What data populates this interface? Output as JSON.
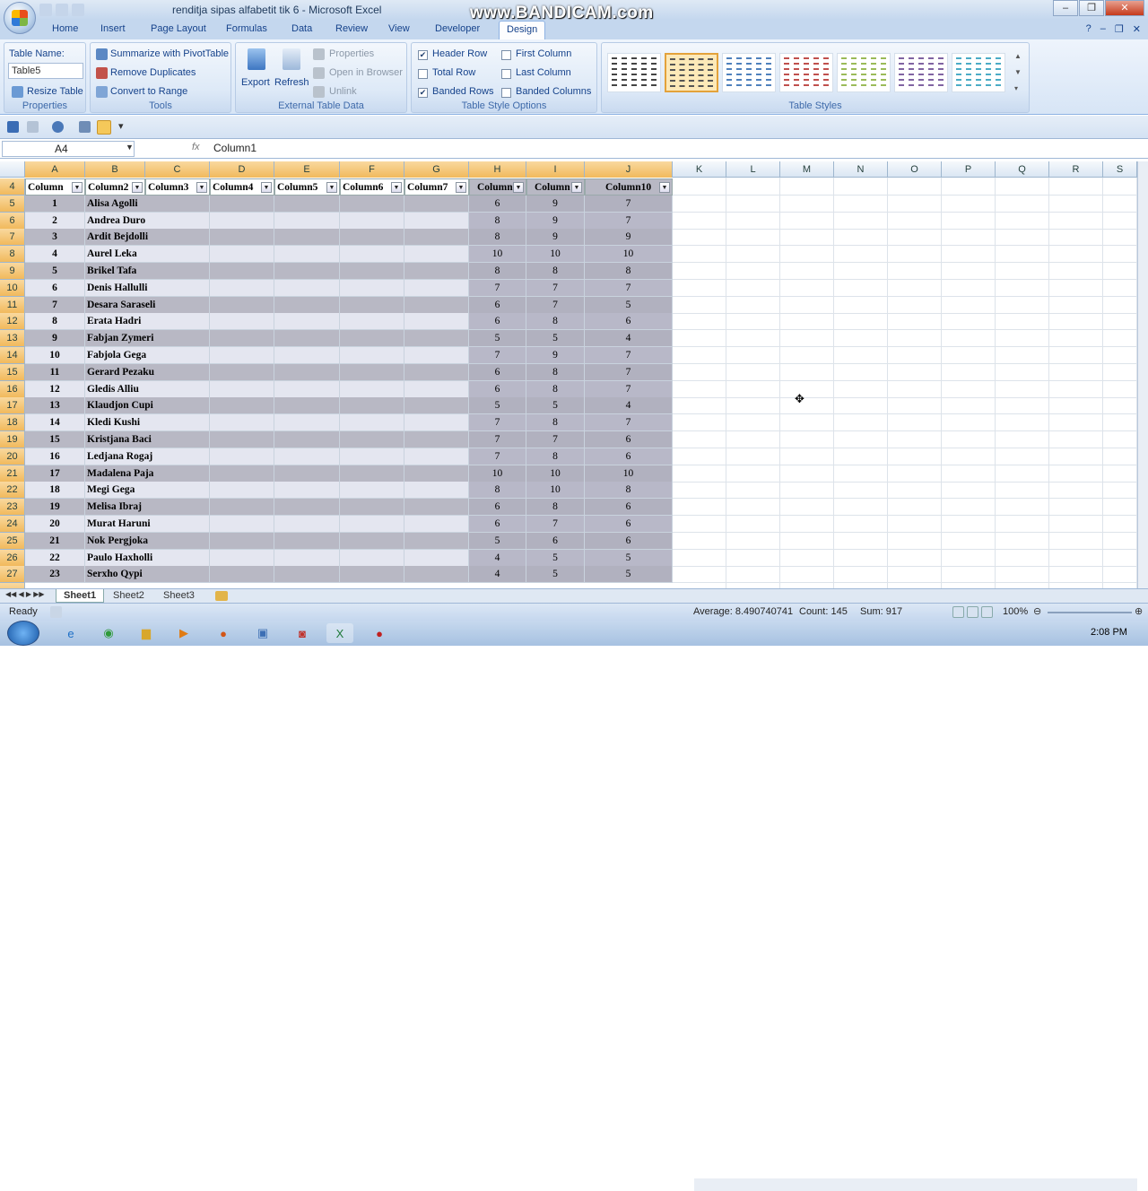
{
  "titlebar": {
    "title": "renditja sipas alfabetit tik 6 - Microsoft Excel",
    "watermark": "www.BANDICAM.com"
  },
  "tabs": [
    "Home",
    "Insert",
    "Page Layout",
    "Formulas",
    "Data",
    "Review",
    "View",
    "Developer",
    "Design"
  ],
  "active_tab": "Design",
  "ribbon": {
    "properties": {
      "label": "Properties",
      "table_name_label": "Table Name:",
      "table_name_value": "Table5",
      "resize": "Resize Table"
    },
    "tools": {
      "label": "Tools",
      "summarize": "Summarize with PivotTable",
      "remove_dup": "Remove Duplicates",
      "convert": "Convert to Range"
    },
    "external": {
      "label": "External Table Data",
      "export": "Export",
      "refresh": "Refresh",
      "properties": "Properties",
      "open_browser": "Open in Browser",
      "unlink": "Unlink"
    },
    "style_options": {
      "label": "Table Style Options",
      "header_row": "Header Row",
      "total_row": "Total Row",
      "banded_rows": "Banded Rows",
      "first_column": "First Column",
      "last_column": "Last Column",
      "banded_columns": "Banded Columns",
      "checked": {
        "header_row": true,
        "total_row": false,
        "banded_rows": true,
        "first_column": false,
        "last_column": false,
        "banded_columns": false
      }
    },
    "table_styles": {
      "label": "Table Styles",
      "colors": [
        "#444444",
        "#555555",
        "#4f81bd",
        "#c0504d",
        "#9bbb59",
        "#8064a2",
        "#4bacc6"
      ],
      "selected": 1
    }
  },
  "formula": {
    "name_box": "A4",
    "fx": "fx",
    "value": "Column1"
  },
  "columns": [
    "A",
    "B",
    "C",
    "D",
    "E",
    "F",
    "G",
    "H",
    "I",
    "J",
    "K",
    "L",
    "M",
    "N",
    "O",
    "P",
    "Q",
    "R",
    "S"
  ],
  "header_row": {
    "row": "4",
    "cells": [
      "Column",
      "Column2",
      "Column3",
      "Column4",
      "Column5",
      "Column6",
      "Column7",
      "Column",
      "Column",
      "Column10"
    ]
  },
  "rows": [
    {
      "r": "5",
      "n": "1",
      "name": "Alisa Agolli",
      "h": "6",
      "i": "9",
      "j": "7"
    },
    {
      "r": "6",
      "n": "2",
      "name": "Andrea Duro",
      "h": "8",
      "i": "9",
      "j": "7"
    },
    {
      "r": "7",
      "n": "3",
      "name": "Ardit Bejdolli",
      "h": "8",
      "i": "9",
      "j": "9"
    },
    {
      "r": "8",
      "n": "4",
      "name": "Aurel Leka",
      "h": "10",
      "i": "10",
      "j": "10"
    },
    {
      "r": "9",
      "n": "5",
      "name": "Brikel Tafa",
      "h": "8",
      "i": "8",
      "j": "8"
    },
    {
      "r": "10",
      "n": "6",
      "name": "Denis Hallulli",
      "h": "7",
      "i": "7",
      "j": "7"
    },
    {
      "r": "11",
      "n": "7",
      "name": "Desara Saraseli",
      "h": "6",
      "i": "7",
      "j": "5"
    },
    {
      "r": "12",
      "n": "8",
      "name": "Erata Hadri",
      "h": "6",
      "i": "8",
      "j": "6"
    },
    {
      "r": "13",
      "n": "9",
      "name": "Fabjan Zymeri",
      "h": "5",
      "i": "5",
      "j": "4"
    },
    {
      "r": "14",
      "n": "10",
      "name": "Fabjola Gega",
      "h": "7",
      "i": "9",
      "j": "7"
    },
    {
      "r": "15",
      "n": "11",
      "name": "Gerard Pezaku",
      "h": "6",
      "i": "8",
      "j": "7"
    },
    {
      "r": "16",
      "n": "12",
      "name": "Gledis Alliu",
      "h": "6",
      "i": "8",
      "j": "7"
    },
    {
      "r": "17",
      "n": "13",
      "name": "Klaudjon Cupi",
      "h": "5",
      "i": "5",
      "j": "4"
    },
    {
      "r": "18",
      "n": "14",
      "name": "Kledi Kushi",
      "h": "7",
      "i": "8",
      "j": "7"
    },
    {
      "r": "19",
      "n": "15",
      "name": "Kristjana Baci",
      "h": "7",
      "i": "7",
      "j": "6"
    },
    {
      "r": "20",
      "n": "16",
      "name": "Ledjana  Rogaj",
      "h": "7",
      "i": "8",
      "j": "6"
    },
    {
      "r": "21",
      "n": "17",
      "name": "Madalena Paja",
      "h": "10",
      "i": "10",
      "j": "10"
    },
    {
      "r": "22",
      "n": "18",
      "name": "Megi Gega",
      "h": "8",
      "i": "10",
      "j": "8"
    },
    {
      "r": "23",
      "n": "19",
      "name": "Melisa Ibraj",
      "h": "6",
      "i": "8",
      "j": "6"
    },
    {
      "r": "24",
      "n": "20",
      "name": "Murat Haruni",
      "h": "6",
      "i": "7",
      "j": "6"
    },
    {
      "r": "25",
      "n": "21",
      "name": "Nok Pergjoka",
      "h": "5",
      "i": "6",
      "j": "6"
    },
    {
      "r": "26",
      "n": "22",
      "name": "Paulo Haxholli",
      "h": "4",
      "i": "5",
      "j": "5"
    },
    {
      "r": "27",
      "n": "23",
      "name": "Serxho Qypi",
      "h": "4",
      "i": "5",
      "j": "5"
    }
  ],
  "sheets": [
    "Sheet1",
    "Sheet2",
    "Sheet3"
  ],
  "status": {
    "ready": "Ready",
    "average": "Average: 8.490740741",
    "count": "Count: 145",
    "sum": "Sum: 917",
    "zoom": "100%"
  },
  "clock": "2:08 PM"
}
